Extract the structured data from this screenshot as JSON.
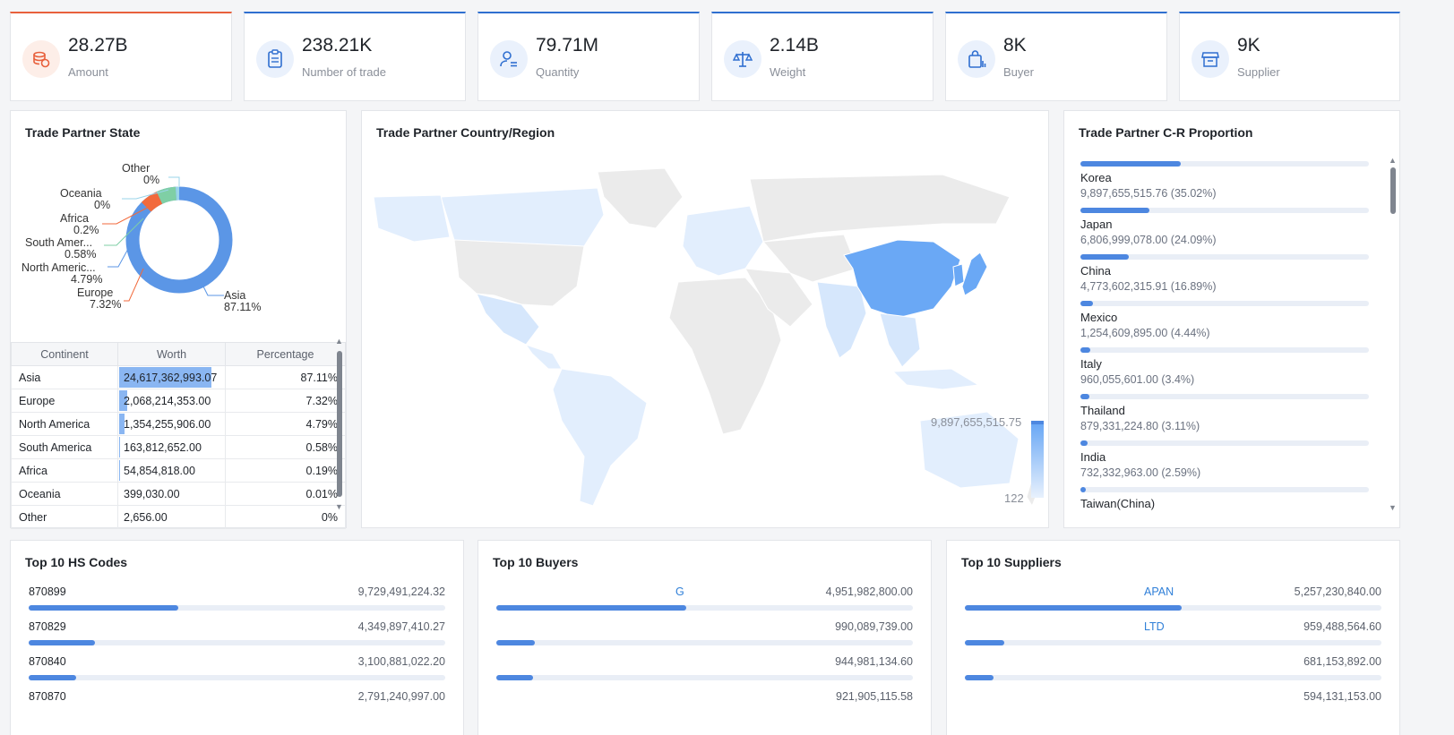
{
  "kpis": [
    {
      "value": "28.27B",
      "label": "Amount",
      "icon": "coins-icon"
    },
    {
      "value": "238.21K",
      "label": "Number of trade",
      "icon": "clipboard-icon"
    },
    {
      "value": "79.71M",
      "label": "Quantity",
      "icon": "user-list-icon"
    },
    {
      "value": "2.14B",
      "label": "Weight",
      "icon": "scale-icon"
    },
    {
      "value": "8K",
      "label": "Buyer",
      "icon": "shopping-bag-icon"
    },
    {
      "value": "9K",
      "label": "Supplier",
      "icon": "store-icon"
    }
  ],
  "state_panel": {
    "title": "Trade Partner State",
    "donut_labels": [
      {
        "name": "Other",
        "pct": "0%"
      },
      {
        "name": "Oceania",
        "pct": "0%"
      },
      {
        "name": "Africa",
        "pct": "0.2%"
      },
      {
        "name": "South Amer...",
        "pct": "0.58%"
      },
      {
        "name": "North Americ...",
        "pct": "4.79%"
      },
      {
        "name": "Europe",
        "pct": "7.32%"
      },
      {
        "name": "Asia",
        "pct": "87.11%"
      }
    ],
    "table": {
      "headers": [
        "Continent",
        "Worth",
        "Percentage"
      ],
      "rows": [
        {
          "continent": "Asia",
          "worth": "24,617,362,993.07",
          "pct": "87.11%",
          "share": 0.8711
        },
        {
          "continent": "Europe",
          "worth": "2,068,214,353.00",
          "pct": "7.32%",
          "share": 0.0732
        },
        {
          "continent": "North America",
          "worth": "1,354,255,906.00",
          "pct": "4.79%",
          "share": 0.0479
        },
        {
          "continent": "South America",
          "worth": "163,812,652.00",
          "pct": "0.58%",
          "share": 0.0058
        },
        {
          "continent": "Africa",
          "worth": "54,854,818.00",
          "pct": "0.19%",
          "share": 0.0019
        },
        {
          "continent": "Oceania",
          "worth": "399,030.00",
          "pct": "0.01%",
          "share": 0.0001
        },
        {
          "continent": "Other",
          "worth": "2,656.00",
          "pct": "0%",
          "share": 0
        }
      ]
    }
  },
  "map_panel": {
    "title": "Trade Partner Country/Region",
    "legend_max": "9,897,655,515.75",
    "legend_min": "122"
  },
  "cr_panel": {
    "title": "Trade Partner C-R Proportion",
    "items": [
      {
        "name": "Korea",
        "value": "9,897,655,515.76 (35.02%)",
        "share": 0.3502
      },
      {
        "name": "Japan",
        "value": "6,806,999,078.00 (24.09%)",
        "share": 0.2409
      },
      {
        "name": "China",
        "value": "4,773,602,315.91 (16.89%)",
        "share": 0.1689
      },
      {
        "name": "Mexico",
        "value": "1,254,609,895.00 (4.44%)",
        "share": 0.0444
      },
      {
        "name": "Italy",
        "value": "960,055,601.00 (3.4%)",
        "share": 0.034
      },
      {
        "name": "Thailand",
        "value": "879,331,224.80 (3.11%)",
        "share": 0.0311
      },
      {
        "name": "India",
        "value": "732,332,963.00 (2.59%)",
        "share": 0.0259
      },
      {
        "name": "Taiwan(China)",
        "value": "",
        "share": 0.02
      }
    ]
  },
  "hs_panel": {
    "title": "Top 10 HS Codes",
    "rows": [
      {
        "code": "870899",
        "value": "9,729,491,224.32",
        "share": 0.36
      },
      {
        "code": "870829",
        "value": "4,349,897,410.27",
        "share": 0.16
      },
      {
        "code": "870840",
        "value": "3,100,881,022.20",
        "share": 0.115
      },
      {
        "code": "870870",
        "value": "2,791,240,997.00",
        "share": 0.1
      }
    ]
  },
  "buyers_panel": {
    "title": "Top 10 Buyers",
    "rows": [
      {
        "name": "G",
        "value": "4,951,982,800.00",
        "share": 0.455
      },
      {
        "name": "",
        "value": "990,089,739.00",
        "share": 0.092
      },
      {
        "name": "",
        "value": "944,981,134.60",
        "share": 0.088
      },
      {
        "name": "",
        "value": "921,905,115.58",
        "share": 0.086
      }
    ]
  },
  "suppliers_panel": {
    "title": "Top 10 Suppliers",
    "rows": [
      {
        "name": "APAN",
        "value": "5,257,230,840.00",
        "share": 0.52
      },
      {
        "name": "LTD",
        "value": "959,488,564.60",
        "share": 0.095
      },
      {
        "name": "",
        "value": "681,153,892.00",
        "share": 0.068
      },
      {
        "name": "",
        "value": "594,131,153.00",
        "share": 0.06
      }
    ]
  },
  "colors": {
    "accent": "#4d87e0",
    "kpi_first": "#e8603c",
    "donut_asia": "#5b96e6",
    "donut_europe": "#f26a3c",
    "donut_north_america": "#7fcfa5",
    "map_highlight": "#6aa8f5",
    "map_light": "#dceafc",
    "map_base": "#ebebeb"
  }
}
